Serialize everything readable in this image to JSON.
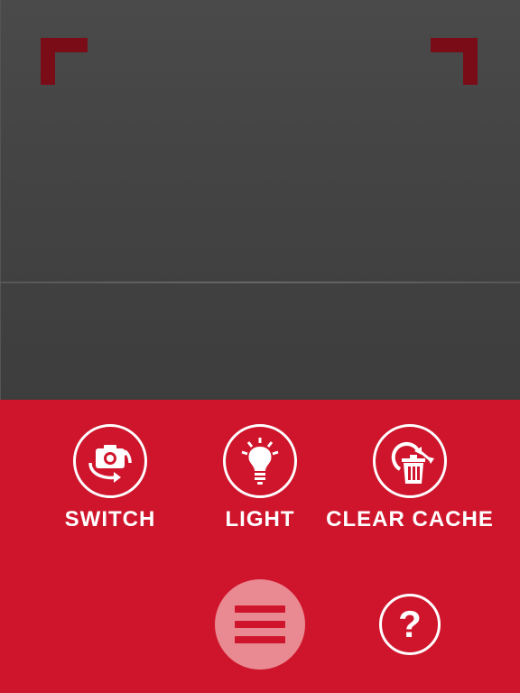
{
  "controls": {
    "switch": {
      "label": "SWITCH",
      "icon": "camera-switch-icon"
    },
    "light": {
      "label": "LIGHT",
      "icon": "lightbulb-icon"
    },
    "clear_cache": {
      "label": "CLEAR CACHE",
      "icon": "clear-cache-icon"
    }
  },
  "bottom": {
    "menu_icon": "hamburger-menu-icon",
    "help_glyph": "?"
  },
  "colors": {
    "panel": "#cf152c",
    "corner_marks": "#7a0c18",
    "menu_button": "#e98a93",
    "icon_stroke": "#ffffff"
  }
}
